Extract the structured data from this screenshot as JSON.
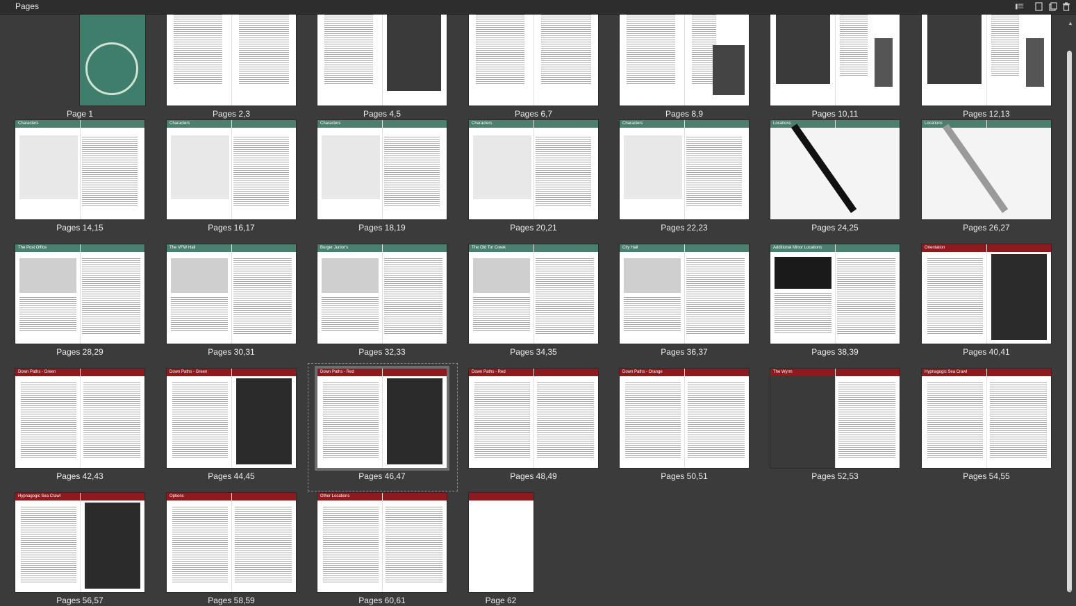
{
  "panel": {
    "title": "Pages",
    "icons": [
      "view-options-icon",
      "single-page-icon",
      "new-page-icon",
      "trash-icon"
    ]
  },
  "colors": {
    "panel_bg": "#3b3b3b",
    "green_header": "#4b7f6f",
    "red_header": "#8c1a1f",
    "cover_green": "#3f7e6c"
  },
  "pages": [
    {
      "label": "Page 1",
      "kind": "cover",
      "header": ""
    },
    {
      "label": "Pages 2,3",
      "kind": "text",
      "header": ""
    },
    {
      "label": "Pages 4,5",
      "kind": "art-right",
      "header": ""
    },
    {
      "label": "Pages 6,7",
      "kind": "text",
      "header": ""
    },
    {
      "label": "Pages 8,9",
      "kind": "text-art",
      "header": ""
    },
    {
      "label": "Pages 10,11",
      "kind": "art-left",
      "header": ""
    },
    {
      "label": "Pages 12,13",
      "kind": "art-left",
      "header": ""
    },
    {
      "label": "Pages 14,15",
      "kind": "char",
      "header": "Characters"
    },
    {
      "label": "Pages 16,17",
      "kind": "char",
      "header": "Characters"
    },
    {
      "label": "Pages 18,19",
      "kind": "char",
      "header": "Characters"
    },
    {
      "label": "Pages 20,21",
      "kind": "char",
      "header": "Characters"
    },
    {
      "label": "Pages 22,23",
      "kind": "char",
      "header": "Characters"
    },
    {
      "label": "Pages 24,25",
      "kind": "map",
      "header": "Locations"
    },
    {
      "label": "Pages 26,27",
      "kind": "map-grey",
      "header": "Locations"
    },
    {
      "label": "Pages 28,29",
      "kind": "loc",
      "header": "The Post Office"
    },
    {
      "label": "Pages 30,31",
      "kind": "loc",
      "header": "The VFW Hall"
    },
    {
      "label": "Pages 32,33",
      "kind": "loc",
      "header": "Burger Junior's"
    },
    {
      "label": "Pages 34,35",
      "kind": "loc",
      "header": "The Old Tor Creek"
    },
    {
      "label": "Pages 36,37",
      "kind": "loc",
      "header": "City Hall"
    },
    {
      "label": "Pages 38,39",
      "kind": "loc-art",
      "header": "Additional Minor Locations"
    },
    {
      "label": "Pages 40,41",
      "kind": "red-art",
      "header": "Orientation"
    },
    {
      "label": "Pages 42,43",
      "kind": "red-text",
      "header": "Down Paths - Green"
    },
    {
      "label": "Pages 44,45",
      "kind": "red-art",
      "header": "Down Paths - Green"
    },
    {
      "label": "Pages 46,47",
      "kind": "red-art",
      "header": "Down Paths - Red",
      "selected": true
    },
    {
      "label": "Pages 48,49",
      "kind": "red-text",
      "header": "Down Paths - Red"
    },
    {
      "label": "Pages 50,51",
      "kind": "red-text",
      "header": "Down Paths - Orange"
    },
    {
      "label": "Pages 52,53",
      "kind": "red-art-left",
      "header": "The Wyrm"
    },
    {
      "label": "Pages 54,55",
      "kind": "red-text",
      "header": "Hypnagogic Sea Crawl"
    },
    {
      "label": "Pages 56,57",
      "kind": "red-art",
      "header": "Hypnagogic Sea Crawl"
    },
    {
      "label": "Pages 58,59",
      "kind": "red-text",
      "header": "Options"
    },
    {
      "label": "Pages 60,61",
      "kind": "red-text",
      "header": "Other Locations"
    },
    {
      "label": "Page 62",
      "kind": "red-single",
      "header": ""
    }
  ]
}
